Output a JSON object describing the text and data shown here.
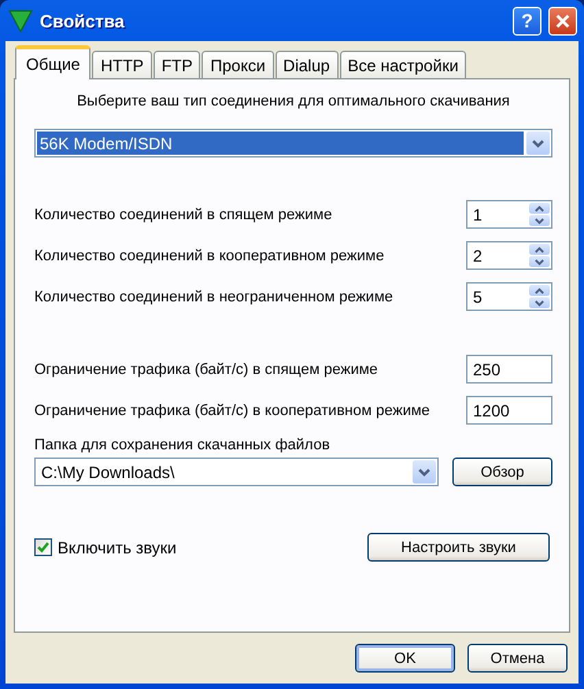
{
  "window": {
    "title": "Свойства",
    "help_button": "?"
  },
  "tabs": [
    {
      "label": "Общие",
      "selected": true
    },
    {
      "label": "HTTP",
      "selected": false
    },
    {
      "label": "FTP",
      "selected": false
    },
    {
      "label": "Прокси",
      "selected": false
    },
    {
      "label": "Dialup",
      "selected": false
    },
    {
      "label": "Все настройки",
      "selected": false
    }
  ],
  "connection_prompt": "Выберите ваш тип соединения для оптимального скачивания",
  "connection_type": {
    "value": "56K Modem/ISDN",
    "focused": true
  },
  "connection_limits": [
    {
      "label": "Количество соединений в спящем режиме",
      "value": "1"
    },
    {
      "label": "Количество соединений в кооперативном режиме",
      "value": "2"
    },
    {
      "label": "Количество соединений в неограниченном режиме",
      "value": "5"
    }
  ],
  "traffic_limits": [
    {
      "label": "Ограничение трафика (байт/с) в спящем режиме",
      "value": "250"
    },
    {
      "label": "Ограничение трафика (байт/с) в кооперативном режиме",
      "value": "1200"
    }
  ],
  "download_folder": {
    "label": "Папка для сохранения скачанных файлов",
    "value": "C:\\My Downloads\\",
    "browse_button": "Обзор"
  },
  "sounds": {
    "label": "Включить звуки",
    "checked": true,
    "setup_button": "Настроить звуки"
  },
  "buttons": [
    {
      "label": "OK",
      "default": true
    },
    {
      "label": "Отмена",
      "default": false
    }
  ]
}
